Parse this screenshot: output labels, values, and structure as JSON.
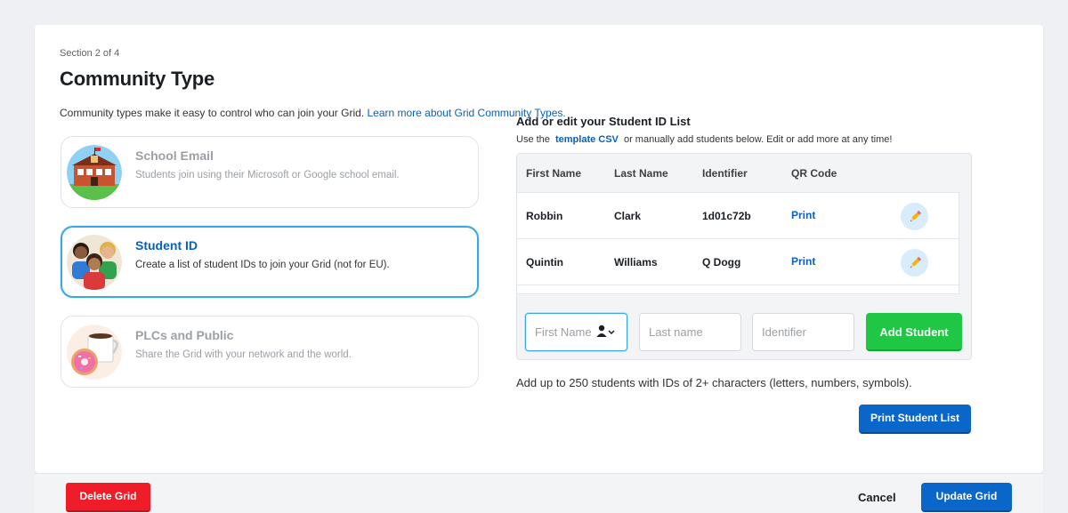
{
  "section": {
    "label": "Section 2 of 4",
    "title": "Community Type"
  },
  "description": {
    "text": "Community types make it easy to control who can join your Grid. ",
    "link": "Learn more about Grid Community Types."
  },
  "community_types": [
    {
      "title": "School Email",
      "desc": "Students join using their Microsoft or Google school email.",
      "icon": "school-building-icon",
      "selected": false
    },
    {
      "title": "Student ID",
      "desc": "Create a list of student IDs to join your Grid (not for EU).",
      "icon": "students-group-icon",
      "selected": true
    },
    {
      "title": "PLCs and Public",
      "desc": "Share the Grid with your network and the world.",
      "icon": "coffee-donut-icon",
      "selected": false
    }
  ],
  "student_list": {
    "heading": "Add or edit your Student ID List",
    "sub_before": "Use the",
    "sub_link": "template CSV",
    "sub_after": "or manually add students below. Edit or add more at any time!",
    "columns": [
      "First Name",
      "Last Name",
      "Identifier",
      "QR Code"
    ],
    "rows": [
      {
        "first": "Robbin",
        "last": "Clark",
        "id": "1d01c72b",
        "qr": "Print"
      },
      {
        "first": "Quintin",
        "last": "Williams",
        "id": "Q Dogg",
        "qr": "Print"
      }
    ]
  },
  "add_form": {
    "first_placeholder": "First Name",
    "last_placeholder": "Last name",
    "id_placeholder": "Identifier",
    "add_label": "Add Student"
  },
  "limit_note": "Add up to 250 students with IDs of 2+ characters (letters, numbers, symbols).",
  "print_list_label": "Print Student List",
  "footer": {
    "delete_label": "Delete Grid",
    "cancel_label": "Cancel",
    "update_label": "Update Grid"
  },
  "colors": {
    "brand_blue": "#0a66c9",
    "link_blue": "#0a5fbf",
    "add_green": "#20c744",
    "delete_red": "#ef1d2a",
    "selected_border": "#3aa6e6"
  }
}
